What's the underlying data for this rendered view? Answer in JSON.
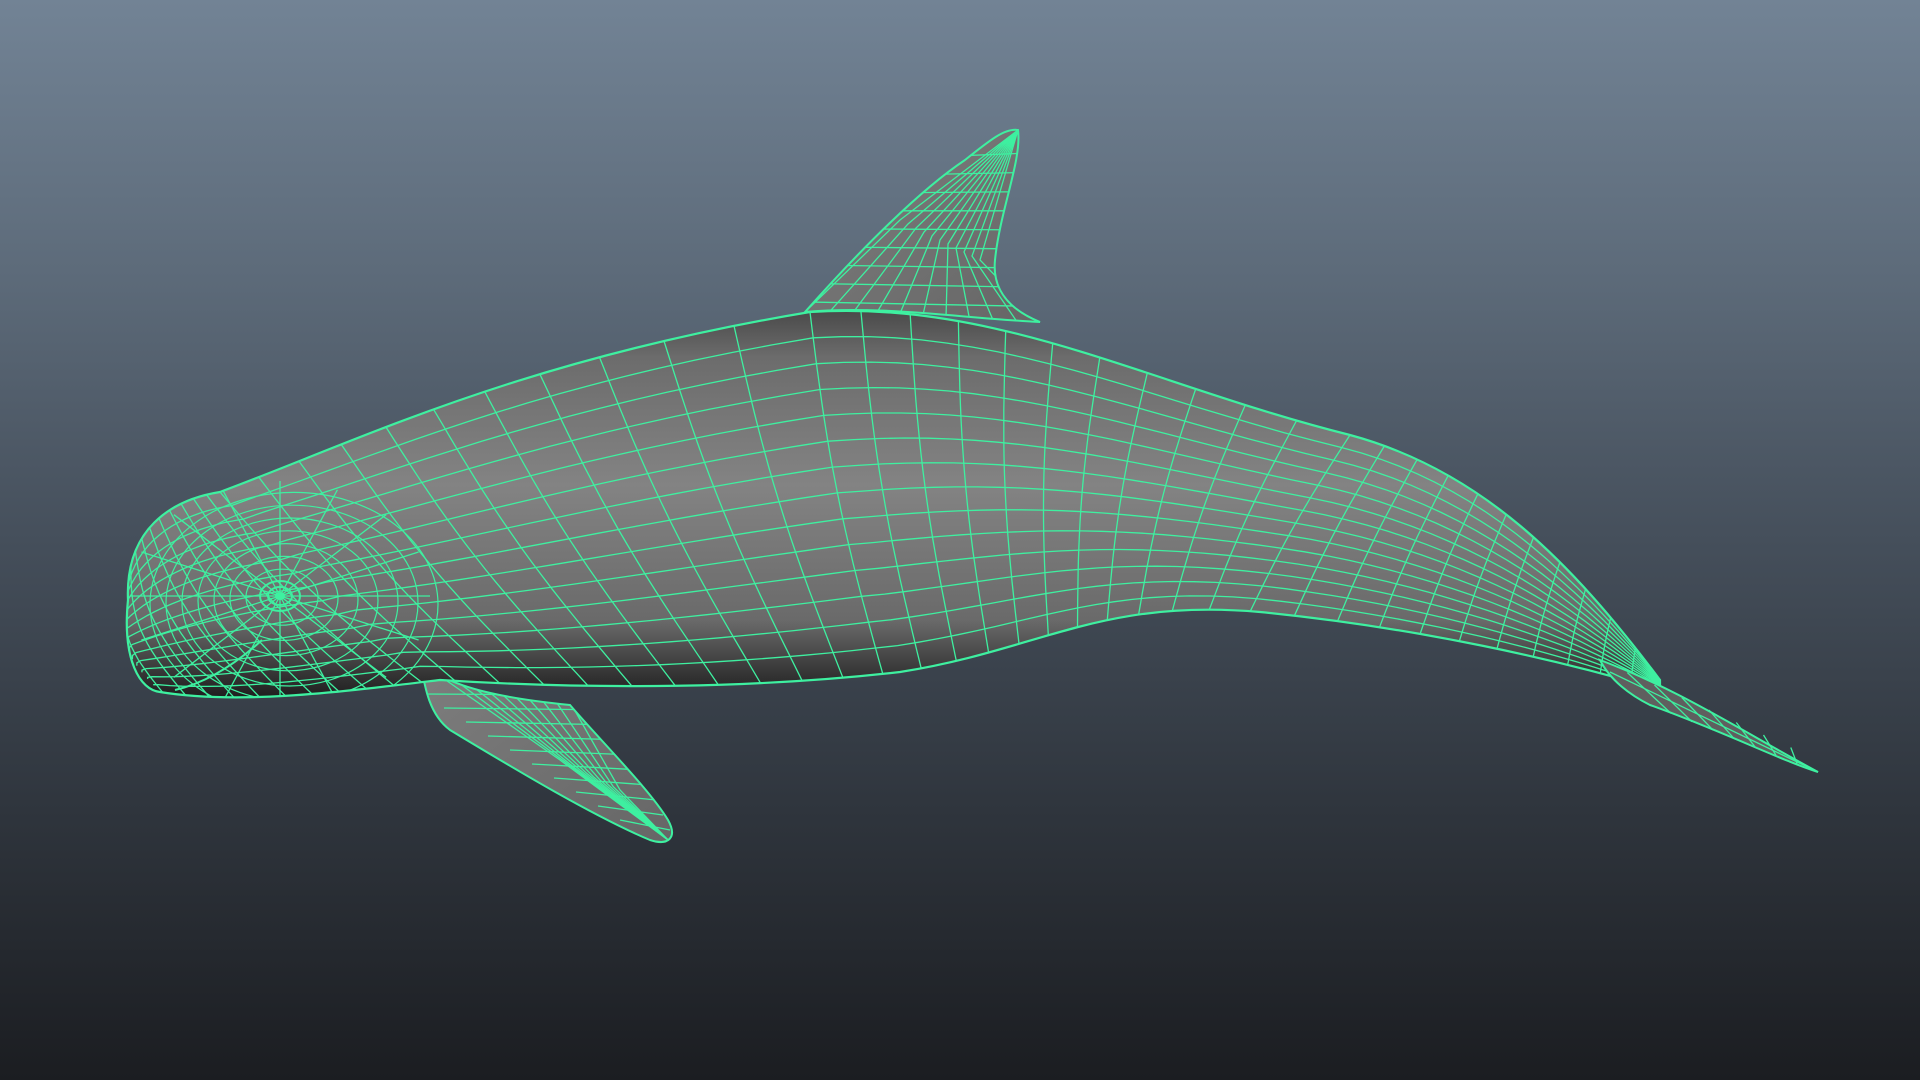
{
  "viewport": {
    "background_top": "#728395",
    "background_bottom": "#1b1d21"
  },
  "model": {
    "subject": "whale-mesh",
    "shading": "smooth-shaded-with-wireframe-on-shaded",
    "surface_color": "#7a7a7a",
    "wireframe_color": "#3ef0a0",
    "selected": true
  }
}
